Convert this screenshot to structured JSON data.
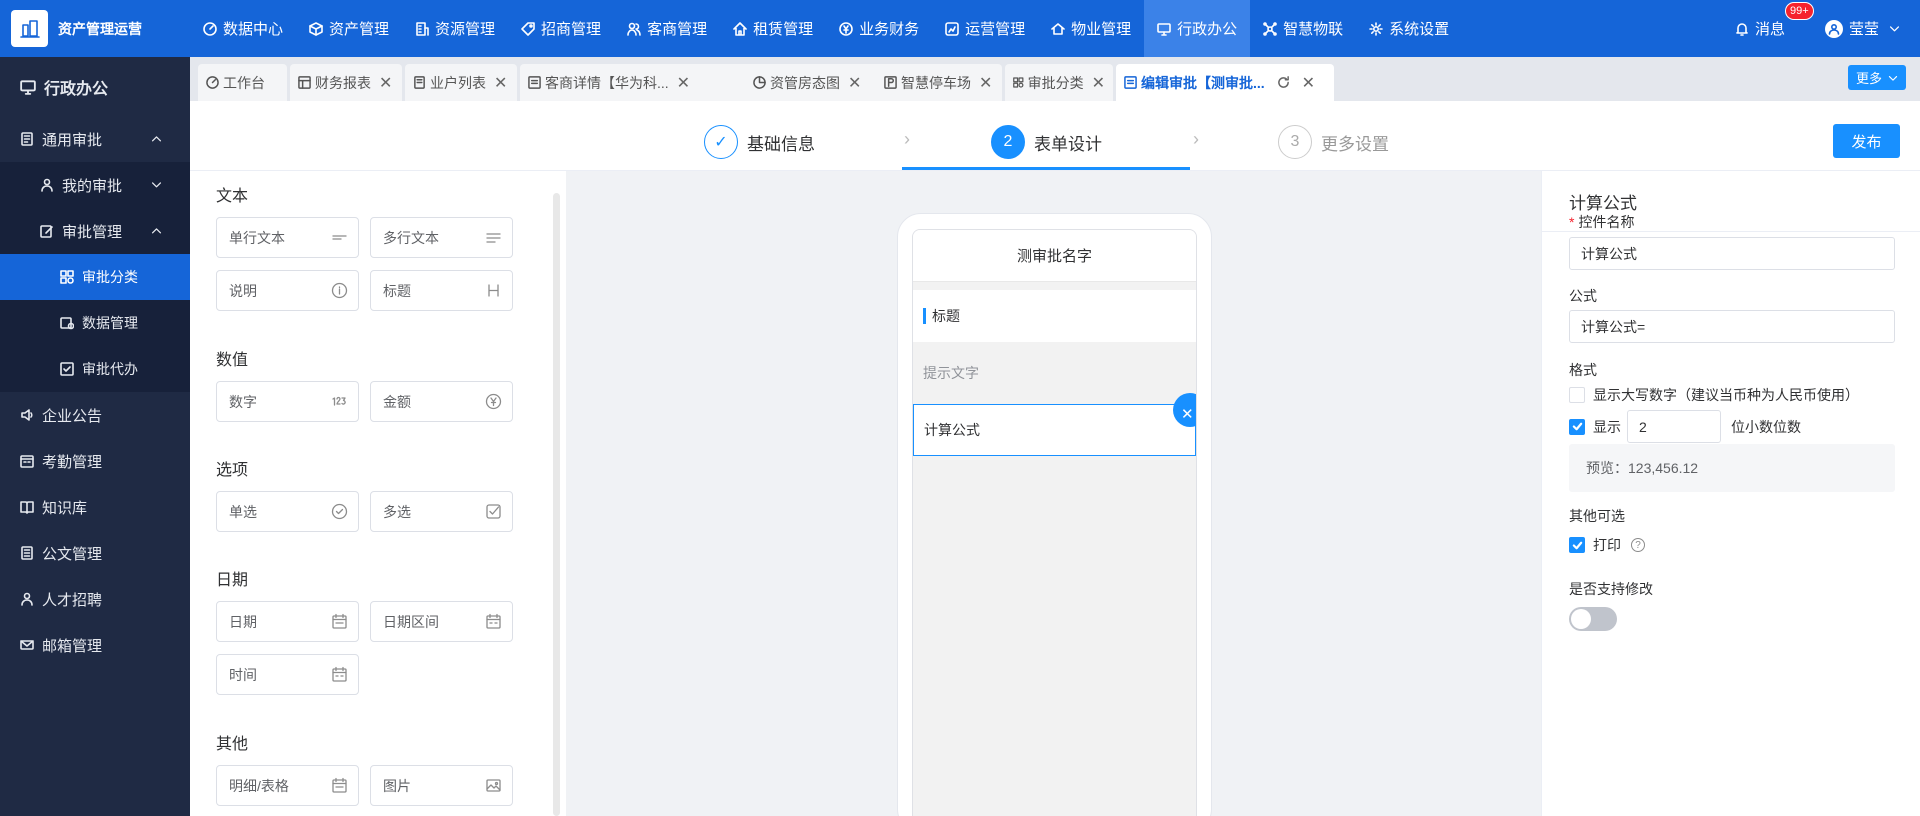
{
  "app": {
    "name": "资产管理运营"
  },
  "topnav": [
    {
      "label": "数据中心",
      "icon": "dashboard-icon"
    },
    {
      "label": "资产管理",
      "icon": "cube-icon"
    },
    {
      "label": "资源管理",
      "icon": "building-icon"
    },
    {
      "label": "招商管理",
      "icon": "tag-icon"
    },
    {
      "label": "客商管理",
      "icon": "users-icon"
    },
    {
      "label": "租赁管理",
      "icon": "home-icon"
    },
    {
      "label": "业务财务",
      "icon": "yen-icon"
    },
    {
      "label": "运营管理",
      "icon": "chart-icon"
    },
    {
      "label": "物业管理",
      "icon": "house-icon"
    },
    {
      "label": "行政办公",
      "icon": "monitor-icon",
      "active": true
    },
    {
      "label": "智慧物联",
      "icon": "network-icon"
    },
    {
      "label": "系统设置",
      "icon": "gear-icon"
    }
  ],
  "header": {
    "messages_label": "消息",
    "messages_badge": "99+",
    "user_name": "莹莹"
  },
  "sidebar": {
    "title": "行政办公",
    "approval": "通用审批",
    "my_approval": "我的审批",
    "approval_mgmt": "审批管理",
    "approval_category": "审批分类",
    "data_mgmt": "数据管理",
    "approval_proxy": "审批代办",
    "announcements": "企业公告",
    "attendance": "考勤管理",
    "knowledge": "知识库",
    "documents": "公文管理",
    "recruiting": "人才招聘",
    "mailbox": "邮箱管理"
  },
  "tabs": [
    {
      "label": "工作台"
    },
    {
      "label": "财务报表"
    },
    {
      "label": "业户列表"
    },
    {
      "label": "客商详情【华为科..."
    },
    {
      "label": "资管房态图"
    },
    {
      "label": "智慧停车场"
    },
    {
      "label": "审批分类"
    },
    {
      "label": "编辑审批【测审批...",
      "active": true
    }
  ],
  "more_label": "更多",
  "steps": [
    {
      "num": "✓",
      "label": "基础信息"
    },
    {
      "num": "2",
      "label": "表单设计"
    },
    {
      "num": "3",
      "label": "更多设置"
    }
  ],
  "publish_label": "发布",
  "controls": {
    "text_title": "文本",
    "single_text": "单行文本",
    "multi_text": "多行文本",
    "description": "说明",
    "heading": "标题",
    "number_title": "数值",
    "number": "数字",
    "amount": "金额",
    "option_title": "选项",
    "single_select": "单选",
    "multi_select": "多选",
    "date_title": "日期",
    "date": "日期",
    "date_range": "日期区间",
    "time": "时间",
    "other_title": "其他",
    "detail_table": "明细/表格",
    "image": "图片"
  },
  "phone": {
    "header": "测审批名字",
    "title_field": "标题",
    "hint": "提示文字",
    "formula_field": "计算公式"
  },
  "props": {
    "title": "计算公式",
    "name_label": "控件名称",
    "name_value": "计算公式",
    "formula_label": "公式",
    "formula_value": "计算公式=",
    "format_label": "格式",
    "uppercase_label": "显示大写数字（建议当币种为人民币使用）",
    "show_label": "显示",
    "decimals": "2",
    "decimals_suffix": "位小数位数",
    "preview": "预览：123,456.12",
    "other_label": "其他可选",
    "print_label": "打印",
    "editable_label": "是否支持修改",
    "uppercase_checked": false,
    "decimals_checked": true,
    "print_checked": true,
    "editable_on": false
  }
}
